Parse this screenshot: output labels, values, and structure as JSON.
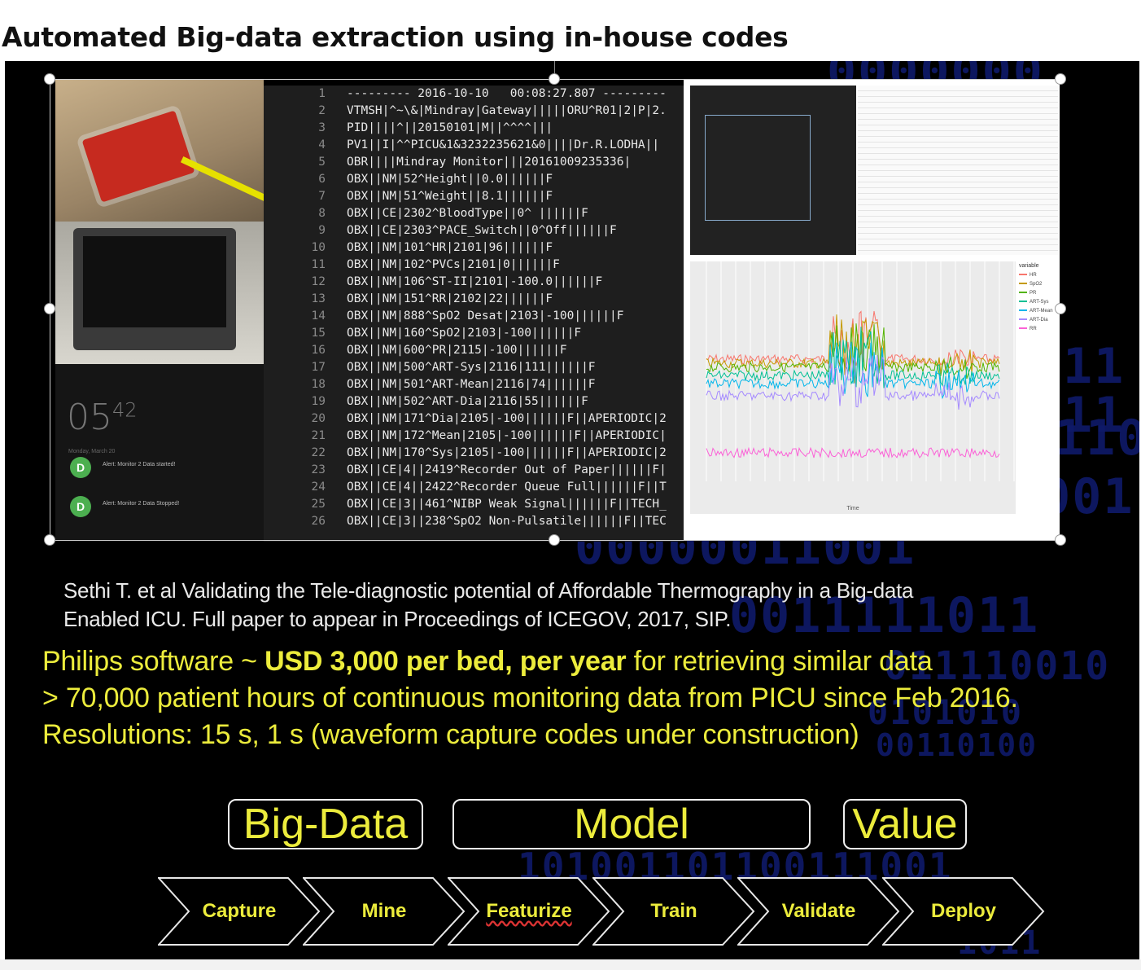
{
  "title": "Automated Big-data extraction using in-house codes",
  "phone": {
    "clock_hours": "05",
    "clock_minutes": "42",
    "date": "Monday, March 20",
    "notifications": [
      {
        "icon": "D",
        "text": "Alert: Monitor 2 Data started!"
      },
      {
        "icon": "D",
        "text": "Alert: Monitor 2 Data Stopped!"
      }
    ]
  },
  "code_lines": [
    {
      "n": "1",
      "t": "--------- 2016-10-10   00:08:27.807 ---------"
    },
    {
      "n": "2",
      "t": "VTMSH|^~\\&|Mindray|Gateway|||||ORU^R01|2|P|2."
    },
    {
      "n": "3",
      "t": "PID||||^||20150101|M||^^^^|||"
    },
    {
      "n": "4",
      "t": "PV1||I|^^PICU&1&3232235621&0||||Dr.R.LODHA||"
    },
    {
      "n": "5",
      "t": "OBR||||Mindray Monitor|||20161009235336|"
    },
    {
      "n": "6",
      "t": "OBX||NM|52^Height||0.0||||||F"
    },
    {
      "n": "7",
      "t": "OBX||NM|51^Weight||8.1||||||F"
    },
    {
      "n": "8",
      "t": "OBX||CE|2302^BloodType||0^ ||||||F"
    },
    {
      "n": "9",
      "t": "OBX||CE|2303^PACE_Switch||0^Off||||||F"
    },
    {
      "n": "10",
      "t": "OBX||NM|101^HR|2101|96||||||F"
    },
    {
      "n": "11",
      "t": "OBX||NM|102^PVCs|2101|0||||||F"
    },
    {
      "n": "12",
      "t": "OBX||NM|106^ST-II|2101|-100.0||||||F"
    },
    {
      "n": "13",
      "t": "OBX||NM|151^RR|2102|22||||||F"
    },
    {
      "n": "14",
      "t": "OBX||NM|888^SpO2 Desat|2103|-100||||||F"
    },
    {
      "n": "15",
      "t": "OBX||NM|160^SpO2|2103|-100||||||F"
    },
    {
      "n": "16",
      "t": "OBX||NM|600^PR|2115|-100||||||F"
    },
    {
      "n": "17",
      "t": "OBX||NM|500^ART-Sys|2116|111||||||F"
    },
    {
      "n": "18",
      "t": "OBX||NM|501^ART-Mean|2116|74||||||F"
    },
    {
      "n": "19",
      "t": "OBX||NM|502^ART-Dia|2116|55||||||F"
    },
    {
      "n": "20",
      "t": "OBX||NM|171^Dia|2105|-100||||||F||APERIODIC|2"
    },
    {
      "n": "21",
      "t": "OBX||NM|172^Mean|2105|-100||||||F||APERIODIC|"
    },
    {
      "n": "22",
      "t": "OBX||NM|170^Sys|2105|-100||||||F||APERIODIC|2"
    },
    {
      "n": "23",
      "t": "OBX||CE|4||2419^Recorder Out of Paper||||||F|"
    },
    {
      "n": "24",
      "t": "OBX||CE|4||2422^Recorder Queue Full||||||F||T"
    },
    {
      "n": "25",
      "t": "OBX||CE|3||461^NIBP Weak Signal||||||F||TECH_"
    },
    {
      "n": "26",
      "t": "OBX||CE|3||238^SpO2 Non-Pulsatile||||||F||TEC"
    }
  ],
  "plot": {
    "legend_title": "variable",
    "legend_items": [
      {
        "name": "HR",
        "color": "#f8766d"
      },
      {
        "name": "SpO2",
        "color": "#c49a00"
      },
      {
        "name": "PR",
        "color": "#53b400"
      },
      {
        "name": "ART-Sys",
        "color": "#00c094"
      },
      {
        "name": "ART-Mean",
        "color": "#00b6eb"
      },
      {
        "name": "ART-Dia",
        "color": "#a58aff"
      },
      {
        "name": "RR",
        "color": "#fb61d7"
      }
    ],
    "xlabel": "Time"
  },
  "citation": {
    "line1": "Sethi T. et al Validating the Tele-diagnostic potential of Affordable Thermography in a Big-data",
    "line2": "Enabled  ICU. Full paper to appear in Proceedings of ICEGOV, 2017, SIP."
  },
  "highlights": {
    "line1_pre": "Philips software ~ ",
    "line1_bold": "USD 3,000 per bed, per year",
    "line1_post": " for retrieving similar data",
    "line2": "> 70,000 patient hours of continuous monitoring data from PICU since Feb 2016.",
    "line3": "Resolutions: 15 s, 1 s (waveform capture codes under construction)"
  },
  "boxes": {
    "bigdata": "Big-Data",
    "model": "Model",
    "value": "Value"
  },
  "pipeline": [
    "Capture",
    "Mine",
    "Featurize",
    "Train",
    "Validate",
    "Deploy"
  ],
  "background_digits": [
    "0000000",
    "11",
    "11",
    "110",
    "1001",
    "00000011001",
    "0011111011",
    "011110010",
    "0101010",
    "00110100",
    "101001101100111001",
    "1011"
  ],
  "colors": {
    "slide_bg": "#000000",
    "accent_yellow": "#ecec3c",
    "digit_blue": "#0f1a6a"
  }
}
